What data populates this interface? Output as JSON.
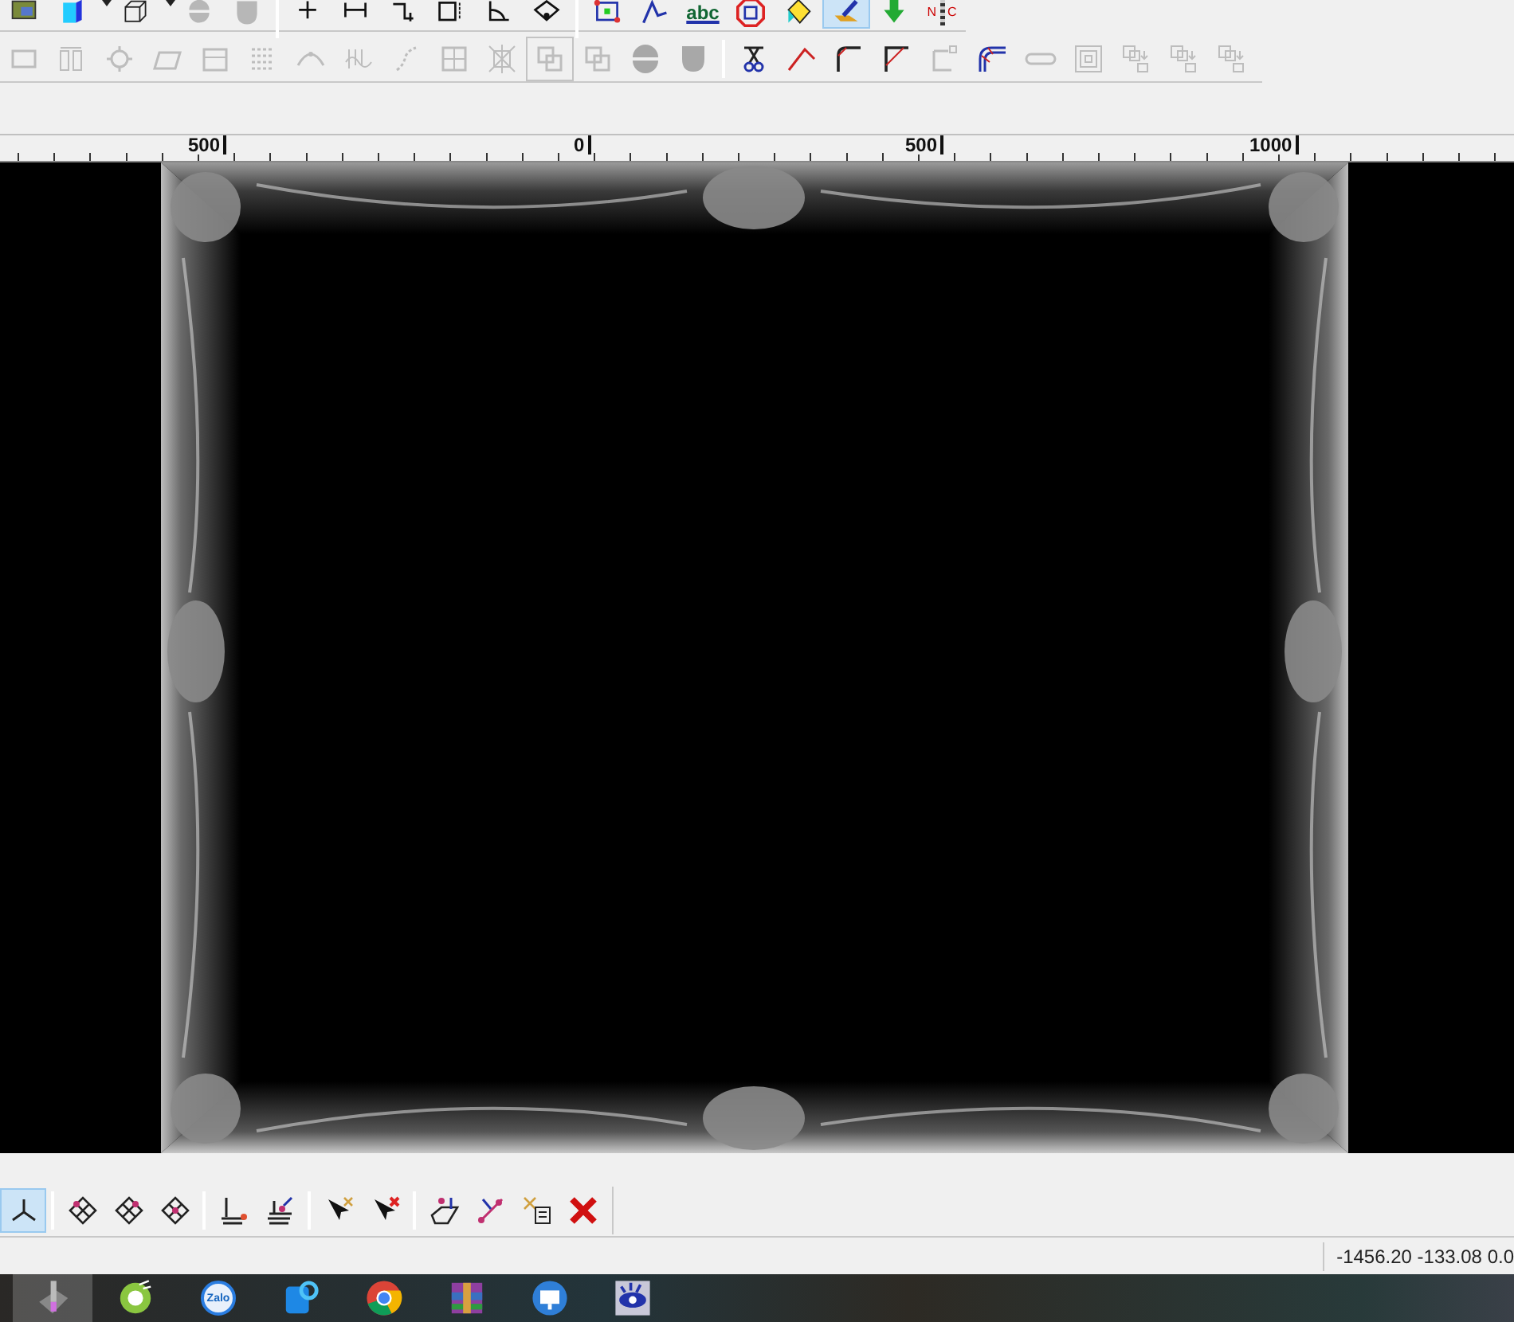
{
  "toolbar_top": {
    "buttons": [
      {
        "selected": false,
        "disabled": false
      },
      {
        "selected": false,
        "disabled": false
      },
      {
        "selected": false,
        "disabled": false
      },
      {
        "selected": false,
        "disabled": true
      },
      {
        "selected": false,
        "disabled": true
      },
      {
        "selected": false,
        "disabled": false
      },
      {
        "selected": false,
        "disabled": false
      },
      {
        "selected": false,
        "disabled": false
      },
      {
        "selected": false,
        "disabled": false
      },
      {
        "selected": false,
        "disabled": false
      },
      {
        "selected": false,
        "disabled": false
      },
      {
        "selected": false,
        "disabled": false
      },
      {
        "selected": false,
        "disabled": false
      },
      {
        "selected": false,
        "disabled": false,
        "label": "abc"
      },
      {
        "selected": false,
        "disabled": false
      },
      {
        "selected": false,
        "disabled": false
      },
      {
        "selected": true,
        "disabled": false
      },
      {
        "selected": false,
        "disabled": false
      },
      {
        "selected": false,
        "disabled": false,
        "label_left": "N",
        "label_right": "C"
      }
    ]
  },
  "toolbar_second": {
    "buttons": [
      {
        "disabled": true
      },
      {
        "disabled": true
      },
      {
        "disabled": true
      },
      {
        "disabled": true
      },
      {
        "disabled": true
      },
      {
        "disabled": true
      },
      {
        "disabled": true
      },
      {
        "disabled": true
      },
      {
        "disabled": true
      },
      {
        "disabled": true
      },
      {
        "disabled": true
      },
      {
        "disabled": true
      },
      {
        "disabled": true
      },
      {
        "disabled": true
      },
      {
        "disabled": true
      },
      {
        "disabled": false
      },
      {
        "disabled": false
      },
      {
        "disabled": false
      },
      {
        "disabled": false
      },
      {
        "disabled": true
      },
      {
        "disabled": false
      },
      {
        "disabled": true
      },
      {
        "disabled": true
      },
      {
        "disabled": true
      },
      {
        "disabled": true
      },
      {
        "disabled": true
      }
    ]
  },
  "ruler": {
    "labels": [
      "500",
      "0",
      "500",
      "1000"
    ]
  },
  "toolbar_bottom": {
    "buttons": [
      {
        "selected": true
      },
      {
        "selected": false
      },
      {
        "selected": false
      },
      {
        "selected": false
      },
      {
        "selected": false
      },
      {
        "selected": false
      },
      {
        "selected": false
      },
      {
        "selected": false
      },
      {
        "selected": false
      },
      {
        "selected": false
      },
      {
        "selected": false
      },
      {
        "selected": false
      }
    ]
  },
  "status_bar": {
    "coordinates": "-1456.20 -133.08 0.0"
  },
  "taskbar": {
    "apps": [
      {
        "selected": true
      },
      {
        "selected": false
      },
      {
        "selected": false,
        "label": "Zalo"
      },
      {
        "selected": false
      },
      {
        "selected": false
      },
      {
        "selected": false
      },
      {
        "selected": false
      },
      {
        "selected": false
      }
    ]
  }
}
